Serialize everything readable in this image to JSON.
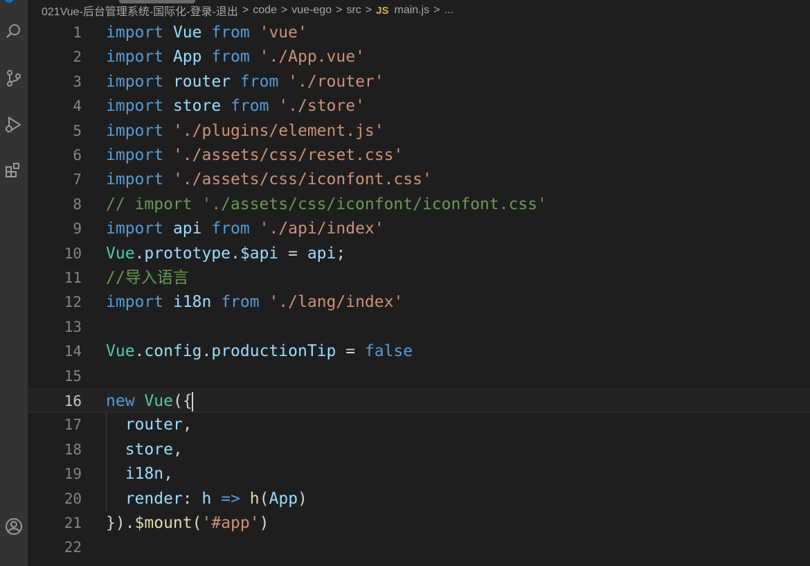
{
  "breadcrumb": {
    "folder": "021Vue-后台管理系统-国际化-登录-退出",
    "parts": [
      "code",
      "vue-ego",
      "src"
    ],
    "file_type_badge": "JS",
    "file": "main.js",
    "trailing": "..."
  },
  "activity_bar": {
    "icons": [
      "explorer-search-icon",
      "source-control-icon",
      "run-debug-icon",
      "extensions-icon",
      "account-icon"
    ]
  },
  "editor": {
    "active_line": 16,
    "lines": [
      {
        "n": "1",
        "tokens": [
          [
            "imp",
            "import"
          ],
          [
            "plain",
            " "
          ],
          [
            "var",
            "Vue"
          ],
          [
            "plain",
            " "
          ],
          [
            "imp",
            "from"
          ],
          [
            "plain",
            " "
          ],
          [
            "str",
            "'vue'"
          ]
        ]
      },
      {
        "n": "2",
        "tokens": [
          [
            "imp",
            "import"
          ],
          [
            "plain",
            " "
          ],
          [
            "var",
            "App"
          ],
          [
            "plain",
            " "
          ],
          [
            "imp",
            "from"
          ],
          [
            "plain",
            " "
          ],
          [
            "str",
            "'./App.vue'"
          ]
        ]
      },
      {
        "n": "3",
        "tokens": [
          [
            "imp",
            "import"
          ],
          [
            "plain",
            " "
          ],
          [
            "var",
            "router"
          ],
          [
            "plain",
            " "
          ],
          [
            "imp",
            "from"
          ],
          [
            "plain",
            " "
          ],
          [
            "str",
            "'./router'"
          ]
        ]
      },
      {
        "n": "4",
        "tokens": [
          [
            "imp",
            "import"
          ],
          [
            "plain",
            " "
          ],
          [
            "var",
            "store"
          ],
          [
            "plain",
            " "
          ],
          [
            "imp",
            "from"
          ],
          [
            "plain",
            " "
          ],
          [
            "str",
            "'./store'"
          ]
        ]
      },
      {
        "n": "5",
        "tokens": [
          [
            "imp",
            "import"
          ],
          [
            "plain",
            " "
          ],
          [
            "str",
            "'./plugins/element.js'"
          ]
        ]
      },
      {
        "n": "6",
        "tokens": [
          [
            "imp",
            "import"
          ],
          [
            "plain",
            " "
          ],
          [
            "str",
            "'./assets/css/reset.css'"
          ]
        ]
      },
      {
        "n": "7",
        "tokens": [
          [
            "imp",
            "import"
          ],
          [
            "plain",
            " "
          ],
          [
            "str",
            "'./assets/css/iconfont.css'"
          ]
        ]
      },
      {
        "n": "8",
        "tokens": [
          [
            "cmt",
            "// import './assets/css/iconfont/iconfont.css'"
          ]
        ]
      },
      {
        "n": "9",
        "tokens": [
          [
            "imp",
            "import"
          ],
          [
            "plain",
            " "
          ],
          [
            "var",
            "api"
          ],
          [
            "plain",
            " "
          ],
          [
            "imp",
            "from"
          ],
          [
            "plain",
            " "
          ],
          [
            "str",
            "'./api/index'"
          ]
        ]
      },
      {
        "n": "10",
        "tokens": [
          [
            "cls",
            "Vue"
          ],
          [
            "plain",
            "."
          ],
          [
            "var",
            "prototype"
          ],
          [
            "plain",
            "."
          ],
          [
            "var",
            "$api"
          ],
          [
            "plain",
            " = "
          ],
          [
            "var",
            "api"
          ],
          [
            "plain",
            ";"
          ]
        ]
      },
      {
        "n": "11",
        "tokens": [
          [
            "cmt",
            "//导入语言"
          ]
        ]
      },
      {
        "n": "12",
        "tokens": [
          [
            "imp",
            "import"
          ],
          [
            "plain",
            " "
          ],
          [
            "var",
            "i18n"
          ],
          [
            "plain",
            " "
          ],
          [
            "imp",
            "from"
          ],
          [
            "plain",
            " "
          ],
          [
            "str",
            "'./lang/index'"
          ]
        ]
      },
      {
        "n": "13",
        "tokens": []
      },
      {
        "n": "14",
        "tokens": [
          [
            "cls",
            "Vue"
          ],
          [
            "plain",
            "."
          ],
          [
            "var",
            "config"
          ],
          [
            "plain",
            "."
          ],
          [
            "var",
            "productionTip"
          ],
          [
            "plain",
            " = "
          ],
          [
            "bool",
            "false"
          ]
        ]
      },
      {
        "n": "15",
        "tokens": []
      },
      {
        "n": "16",
        "tokens": [
          [
            "kw",
            "new"
          ],
          [
            "plain",
            " "
          ],
          [
            "cls",
            "Vue"
          ],
          [
            "plain",
            "("
          ],
          [
            "plain",
            "{"
          ]
        ]
      },
      {
        "n": "17",
        "tokens": [
          [
            "plain",
            "  "
          ],
          [
            "var",
            "router"
          ],
          [
            "plain",
            ","
          ]
        ]
      },
      {
        "n": "18",
        "tokens": [
          [
            "plain",
            "  "
          ],
          [
            "var",
            "store"
          ],
          [
            "plain",
            ","
          ]
        ]
      },
      {
        "n": "19",
        "tokens": [
          [
            "plain",
            "  "
          ],
          [
            "var",
            "i18n"
          ],
          [
            "plain",
            ","
          ]
        ]
      },
      {
        "n": "20",
        "tokens": [
          [
            "plain",
            "  "
          ],
          [
            "var",
            "render"
          ],
          [
            "plain",
            ": "
          ],
          [
            "var",
            "h"
          ],
          [
            "plain",
            " "
          ],
          [
            "kw",
            "=>"
          ],
          [
            "plain",
            " "
          ],
          [
            "fn",
            "h"
          ],
          [
            "plain",
            "("
          ],
          [
            "var",
            "App"
          ],
          [
            "plain",
            ")"
          ]
        ]
      },
      {
        "n": "21",
        "tokens": [
          [
            "plain",
            "})."
          ],
          [
            "fn",
            "$mount"
          ],
          [
            "plain",
            "("
          ],
          [
            "str",
            "'#app'"
          ],
          [
            "plain",
            ")"
          ]
        ]
      },
      {
        "n": "22",
        "tokens": []
      }
    ]
  }
}
